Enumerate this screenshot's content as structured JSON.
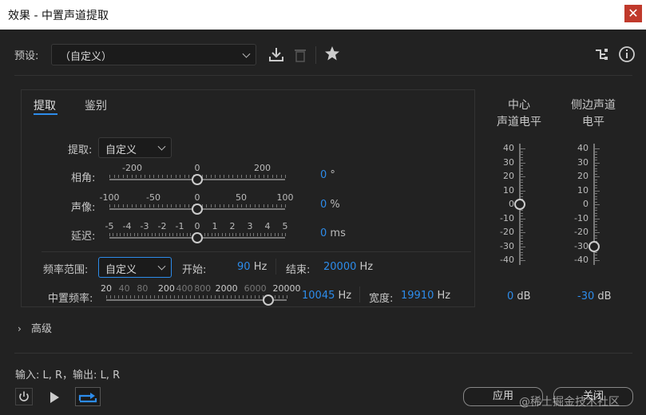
{
  "window": {
    "title": "效果 - 中置声道提取",
    "close_icon": "close-icon"
  },
  "preset": {
    "label": "预设:",
    "value": "（自定义）"
  },
  "tabs": [
    {
      "label": "提取",
      "active": true
    },
    {
      "label": "鉴别",
      "active": false
    }
  ],
  "extract": {
    "label": "提取:",
    "value": "自定义"
  },
  "phase": {
    "label": "相角:",
    "ticks": [
      "-200",
      "0",
      "200"
    ],
    "value": "0",
    "unit": "°",
    "level_deg": 0
  },
  "pan": {
    "label": "声像:",
    "ticks": [
      "-100",
      "-50",
      "0",
      "50",
      "100"
    ],
    "value": "0",
    "unit": "%",
    "level": 0
  },
  "delay": {
    "label": "延迟:",
    "ticks": [
      "-5",
      "-4",
      "-3",
      "-2",
      "-1",
      "0",
      "1",
      "2",
      "3",
      "4",
      "5"
    ],
    "value": "0",
    "unit": "ms",
    "level": 0
  },
  "freq_range": {
    "label": "频率范围:",
    "value": "自定义",
    "start_label": "开始:",
    "start_value": "90",
    "start_unit": "Hz",
    "end_label": "结束:",
    "end_value": "20000",
    "end_unit": "Hz"
  },
  "center_freq": {
    "label": "中置频率:",
    "ticks": [
      "20",
      "40",
      "80",
      "200",
      "400",
      "800",
      "2000",
      "6000",
      "20000"
    ],
    "value": "10045",
    "unit": "Hz",
    "width_label": "宽度:",
    "width_value": "19910",
    "width_unit": "Hz",
    "level_hz": 10045
  },
  "meters": {
    "scale": [
      "40",
      "30",
      "20",
      "10",
      "0",
      "-10",
      "-20",
      "-30",
      "-40"
    ],
    "center": {
      "label_1": "中心",
      "label_2": "声道电平",
      "value": "0",
      "unit": "dB",
      "level_db": 0
    },
    "side": {
      "label_1": "侧边声道",
      "label_2": "电平",
      "value": "-30",
      "unit": "dB",
      "level_db": -30
    }
  },
  "advanced": {
    "label": "高级"
  },
  "io": {
    "label": "输入: L, R，输出: L, R"
  },
  "buttons": {
    "apply": "应用",
    "close": "关闭"
  },
  "watermark": "@稀土掘金技术社区",
  "colors": {
    "accent": "#2d8ceb",
    "background": "#222222"
  }
}
